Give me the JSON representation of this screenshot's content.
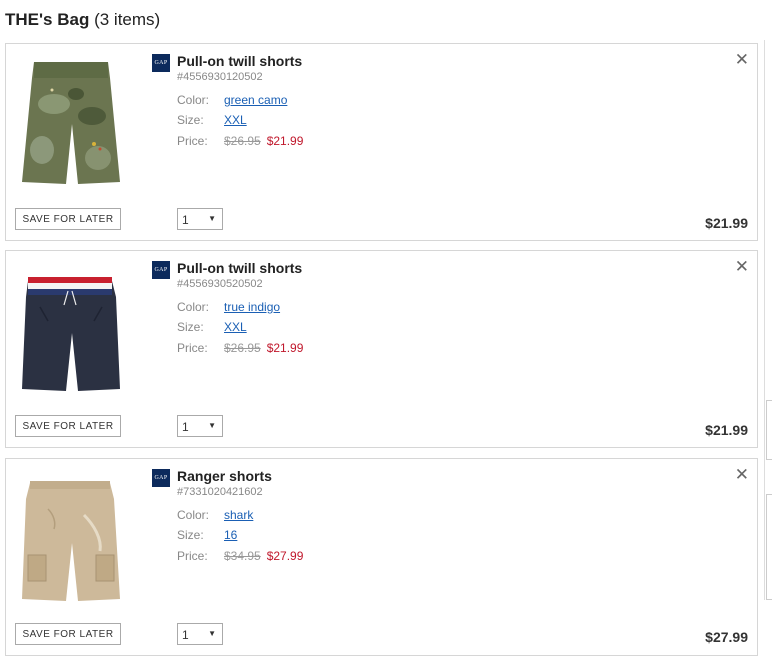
{
  "bag": {
    "title": "THE's Bag",
    "count": "(3 items)"
  },
  "items": [
    {
      "name": "Pull-on twill shorts",
      "sku": "#4556930120502",
      "color_label": "Color:",
      "color": "green camo",
      "size_label": "Size:",
      "size": "XXL",
      "price_label": "Price:",
      "original_price": "$26.95",
      "sale_price": "$21.99",
      "qty": "1",
      "total": "$21.99",
      "save_label": "SAVE FOR LATER",
      "brand": "GAP"
    },
    {
      "name": "Pull-on twill shorts",
      "sku": "#4556930520502",
      "color_label": "Color:",
      "color": "true indigo",
      "size_label": "Size:",
      "size": "XXL",
      "price_label": "Price:",
      "original_price": "$26.95",
      "sale_price": "$21.99",
      "qty": "1",
      "total": "$21.99",
      "save_label": "SAVE FOR LATER",
      "brand": "GAP"
    },
    {
      "name": "Ranger shorts",
      "sku": "#7331020421602",
      "color_label": "Color:",
      "color": "shark",
      "size_label": "Size:",
      "size": "16",
      "price_label": "Price:",
      "original_price": "$34.95",
      "sale_price": "$27.99",
      "qty": "1",
      "total": "$27.99",
      "save_label": "SAVE FOR LATER",
      "brand": "GAP"
    }
  ],
  "icons": {
    "close": "close-icon",
    "dropdown": "chevron-down-icon"
  },
  "colors": {
    "sale": "#c0172b",
    "link": "#1a5fb4",
    "brand_bg": "#0c2a5c"
  }
}
